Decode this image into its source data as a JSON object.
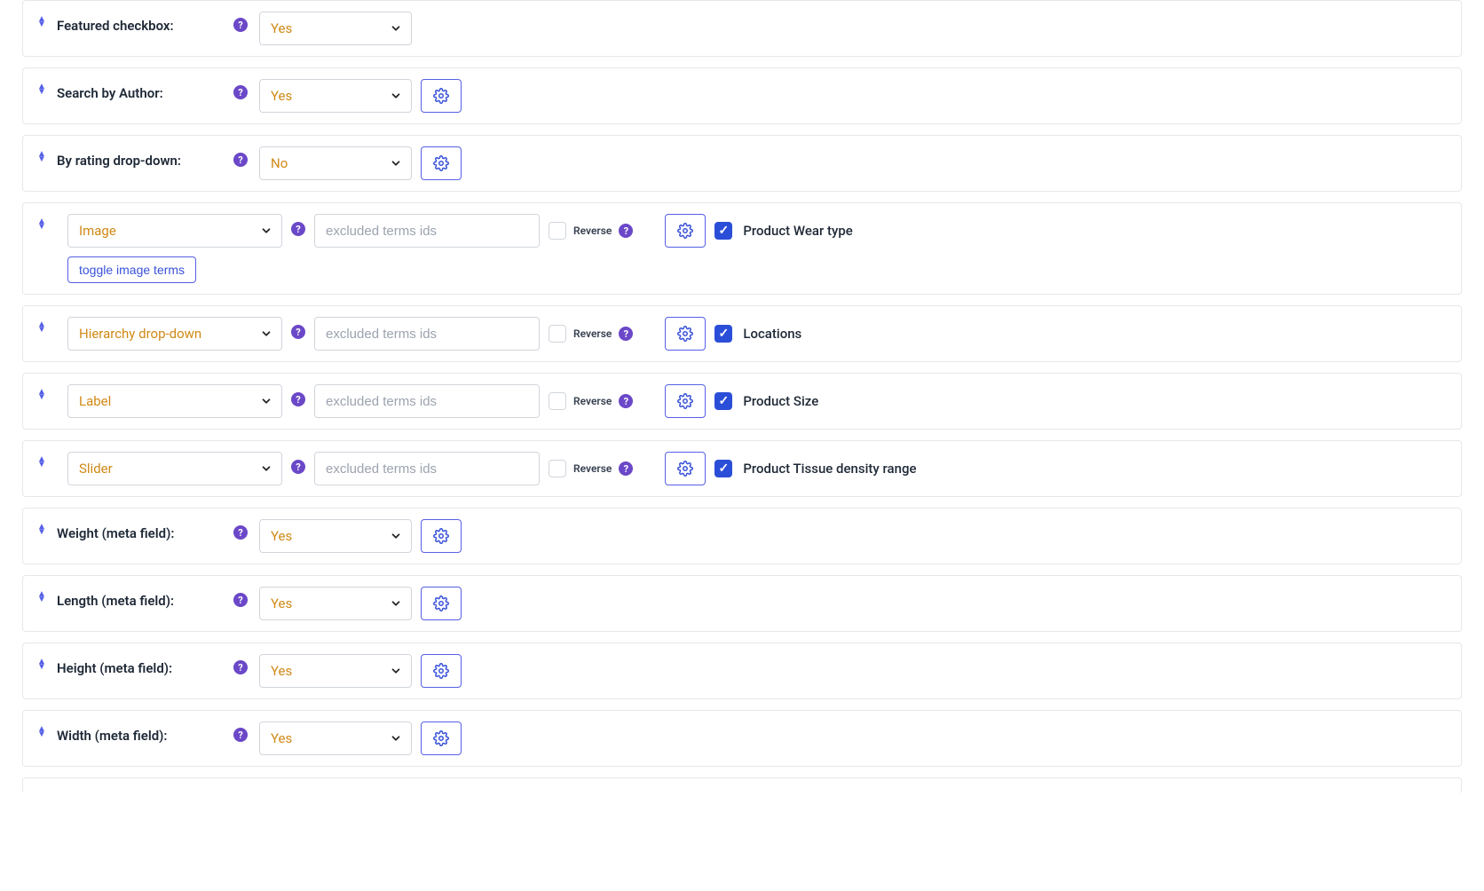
{
  "rows": {
    "featured": {
      "label": "Featured checkbox:",
      "value": "Yes"
    },
    "author": {
      "label": "Search by Author:",
      "value": "Yes"
    },
    "rating": {
      "label": "By rating drop-down:",
      "value": "No"
    },
    "weight": {
      "label": "Weight (meta field):",
      "value": "Yes"
    },
    "length": {
      "label": "Length (meta field):",
      "value": "Yes"
    },
    "height": {
      "label": "Height (meta field):",
      "value": "Yes"
    },
    "width": {
      "label": "Width (meta field):",
      "value": "Yes"
    }
  },
  "tax_rows": {
    "wear": {
      "type_label": "Image",
      "excluded_placeholder": "excluded terms ids",
      "reverse_label": "Reverse",
      "attr_name": "Product Wear type",
      "toggle_label": "toggle image terms"
    },
    "loc": {
      "type_label": "Hierarchy drop-down",
      "excluded_placeholder": "excluded terms ids",
      "reverse_label": "Reverse",
      "attr_name": "Locations"
    },
    "size": {
      "type_label": "Label",
      "excluded_placeholder": "excluded terms ids",
      "reverse_label": "Reverse",
      "attr_name": "Product Size"
    },
    "density": {
      "type_label": "Slider",
      "excluded_placeholder": "excluded terms ids",
      "reverse_label": "Reverse",
      "attr_name": "Product Tissue density range"
    }
  }
}
